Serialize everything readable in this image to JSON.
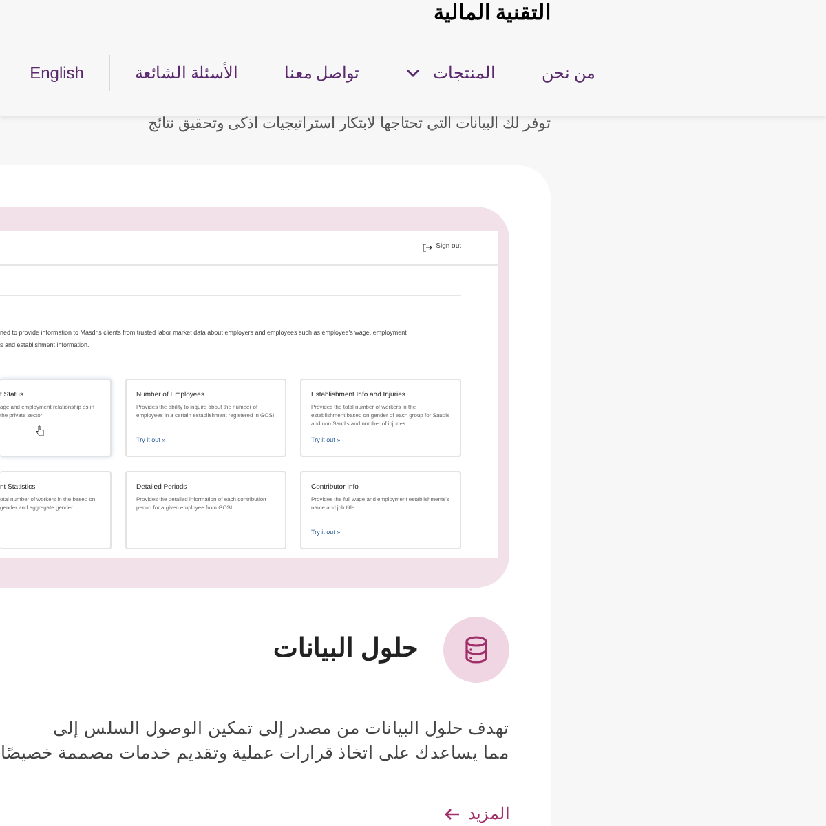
{
  "page_heading": "التقنية المالية",
  "nav": {
    "items": [
      {
        "label": "من نحن",
        "kind": "link"
      },
      {
        "label": "المنتجات",
        "kind": "dropdown"
      },
      {
        "label": "تواصل معنا",
        "kind": "link"
      },
      {
        "label": "الأسئلة الشائعة",
        "kind": "link"
      }
    ],
    "language": "English"
  },
  "intro_line": "توفر لك البيانات التي تحتاجها لابتكار استراتيجيات أذكى وتحقيق نتائج",
  "preview": {
    "sign_out": "Sign out",
    "description": [
      "ned to provide information to Masdr's clients from trusted labor market data about employers and employees such as employee's wage, employment",
      "s and establishment information."
    ],
    "cards": [
      {
        "title": "t Status",
        "text": "age and employment relationship es in the private sector"
      },
      {
        "title": "Number of Employees",
        "text": "Provides the ability to inquire about the number of employees in a certain establishment registered in GOSI",
        "link": "Try it out »"
      },
      {
        "title": "Establishment Info and Injuries",
        "text": "Provides the total number of workers in the establishment based on gender of each group for Saudis and non Saudis and number of injuries",
        "link": "Try it out »"
      },
      {
        "title": "nt Statistics",
        "text": "otal number of workers in the based on gender and aggregate gender"
      },
      {
        "title": "Detailed Periods",
        "text": "Provides the detailed information of each contribution period for a given employee from GOSI"
      },
      {
        "title": "Contributor Info",
        "text": "Provides the full wage and employment establishments's name and job title",
        "link": "Try it out »"
      }
    ]
  },
  "section": {
    "title": "حلول البيانات",
    "text": [
      "تهدف حلول البيانات من مصدر إلى تمكين الوصول السلس إلى",
      "مما يساعدك على اتخاذ قرارات عملية وتقديم خدمات مصممة خصيصًا"
    ],
    "more_link": "المزيد"
  }
}
